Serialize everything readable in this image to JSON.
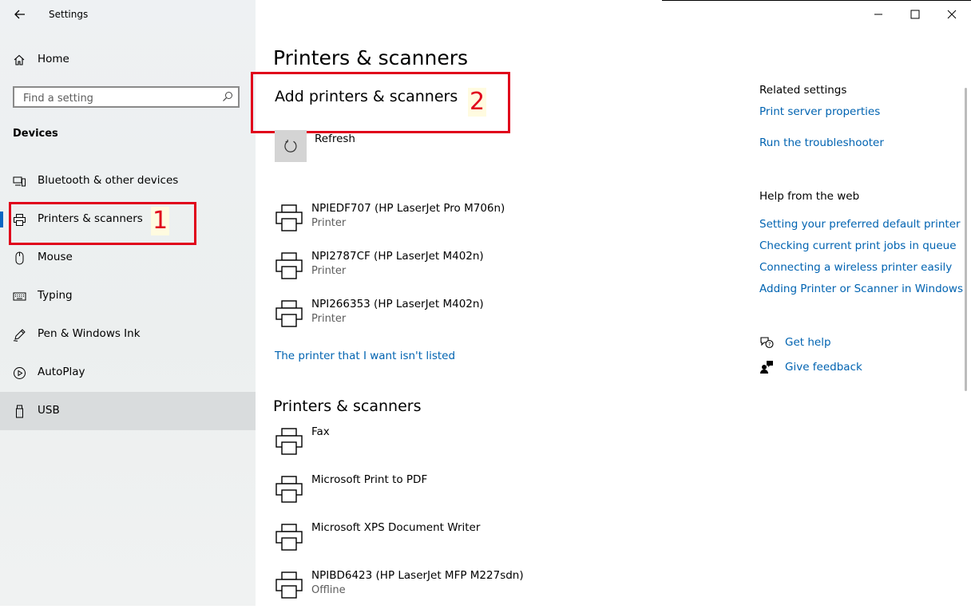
{
  "window": {
    "title": "Settings"
  },
  "sidebar": {
    "home_label": "Home",
    "search_placeholder": "Find a setting",
    "section": "Devices",
    "items": [
      {
        "label": "Bluetooth & other devices",
        "icon": "bluetooth-devices-icon"
      },
      {
        "label": "Printers & scanners",
        "icon": "printer-icon"
      },
      {
        "label": "Mouse",
        "icon": "mouse-icon"
      },
      {
        "label": "Typing",
        "icon": "keyboard-icon"
      },
      {
        "label": "Pen & Windows Ink",
        "icon": "pen-icon"
      },
      {
        "label": "AutoPlay",
        "icon": "autoplay-icon"
      },
      {
        "label": "USB",
        "icon": "usb-icon"
      }
    ],
    "selected_index": 1,
    "hover_index": 6
  },
  "annotations": [
    {
      "number": "1",
      "color": "#e0001b"
    },
    {
      "number": "2",
      "color": "#e0001b"
    }
  ],
  "main": {
    "page_title": "Printers & scanners",
    "add_title": "Add printers & scanners",
    "refresh_label": "Refresh",
    "discovered": [
      {
        "name": "NPIEDF707 (HP LaserJet Pro M706n)",
        "status": "Printer"
      },
      {
        "name": "NPI2787CF (HP LaserJet M402n)",
        "status": "Printer"
      },
      {
        "name": "NPI266353 (HP LaserJet M402n)",
        "status": "Printer"
      }
    ],
    "not_listed_link": "The printer that I want isn't listed",
    "list_title": "Printers & scanners",
    "installed": [
      {
        "name": "Fax",
        "status": ""
      },
      {
        "name": "Microsoft Print to PDF",
        "status": ""
      },
      {
        "name": "Microsoft XPS Document Writer",
        "status": ""
      },
      {
        "name": "NPIBD6423 (HP LaserJet MFP M227sdn)",
        "status": "Offline"
      }
    ]
  },
  "right": {
    "related_title": "Related settings",
    "related_links": [
      "Print server properties",
      "Run the troubleshooter"
    ],
    "web_title": "Help from the web",
    "web_links": [
      "Setting your preferred default printer",
      "Checking current print jobs in queue",
      "Connecting a wireless printer easily",
      "Adding Printer or Scanner in Windows"
    ],
    "get_help": "Get help",
    "give_feedback": "Give feedback"
  },
  "colors": {
    "accent": "#0a66c2",
    "link": "#0063b1",
    "annotation": "#e0001b"
  }
}
